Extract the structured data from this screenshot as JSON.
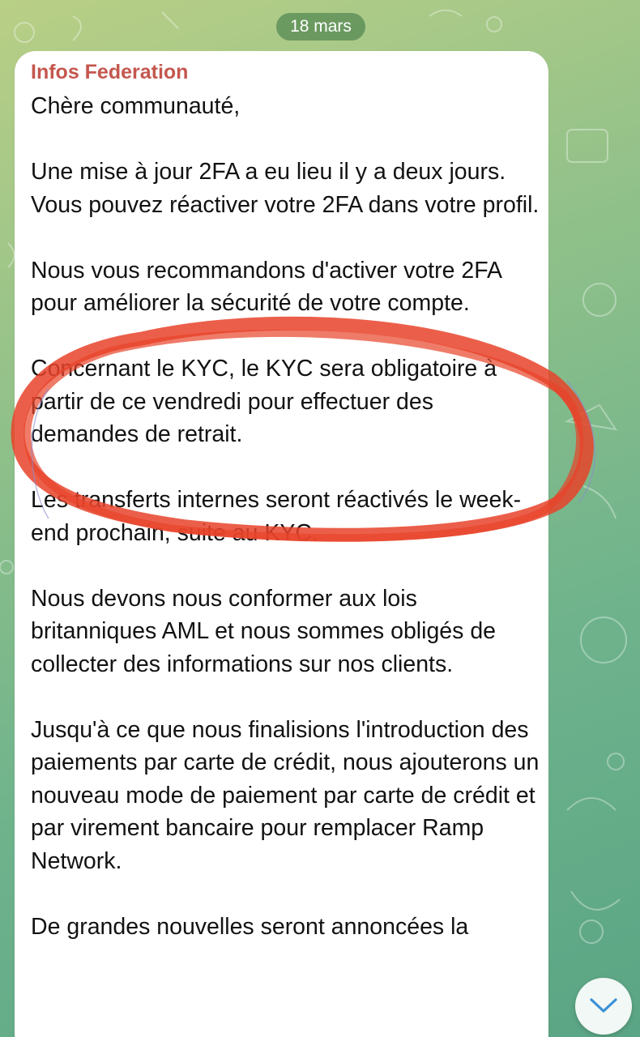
{
  "chat": {
    "date": "18 mars",
    "sender": "Infos Federation",
    "paragraphs": [
      "Chère communauté,",
      "Une mise à jour 2FA a eu lieu il y a deux jours. Vous pouvez réactiver votre 2FA dans votre profil.",
      "Nous vous recommandons d'activer votre 2FA pour améliorer la sécurité de votre compte.",
      "Concernant le KYC, le KYC sera obligatoire à partir de ce vendredi pour effectuer des demandes de retrait.",
      "Les transferts internes seront réactivés le week-end prochain, suite au KYC.",
      "Nous devons nous conformer aux lois britanniques AML et nous sommes obligés de collecter des informations sur nos clients.",
      "Jusqu'à ce que nous finalisions l'introduction des paiements par carte de crédit, nous ajouterons un nouveau mode de paiement par carte de crédit et par virement bancaire pour remplacer Ramp Network.",
      "De grandes nouvelles seront annoncées la"
    ]
  },
  "colors": {
    "sender": "#c4574e",
    "highlight": "#e8432a",
    "bubble": "#ffffff",
    "date_pill": "#588c54"
  },
  "icons": {
    "scroll_down": "chevron-down-icon",
    "annotation": "hand-drawn-circle"
  }
}
